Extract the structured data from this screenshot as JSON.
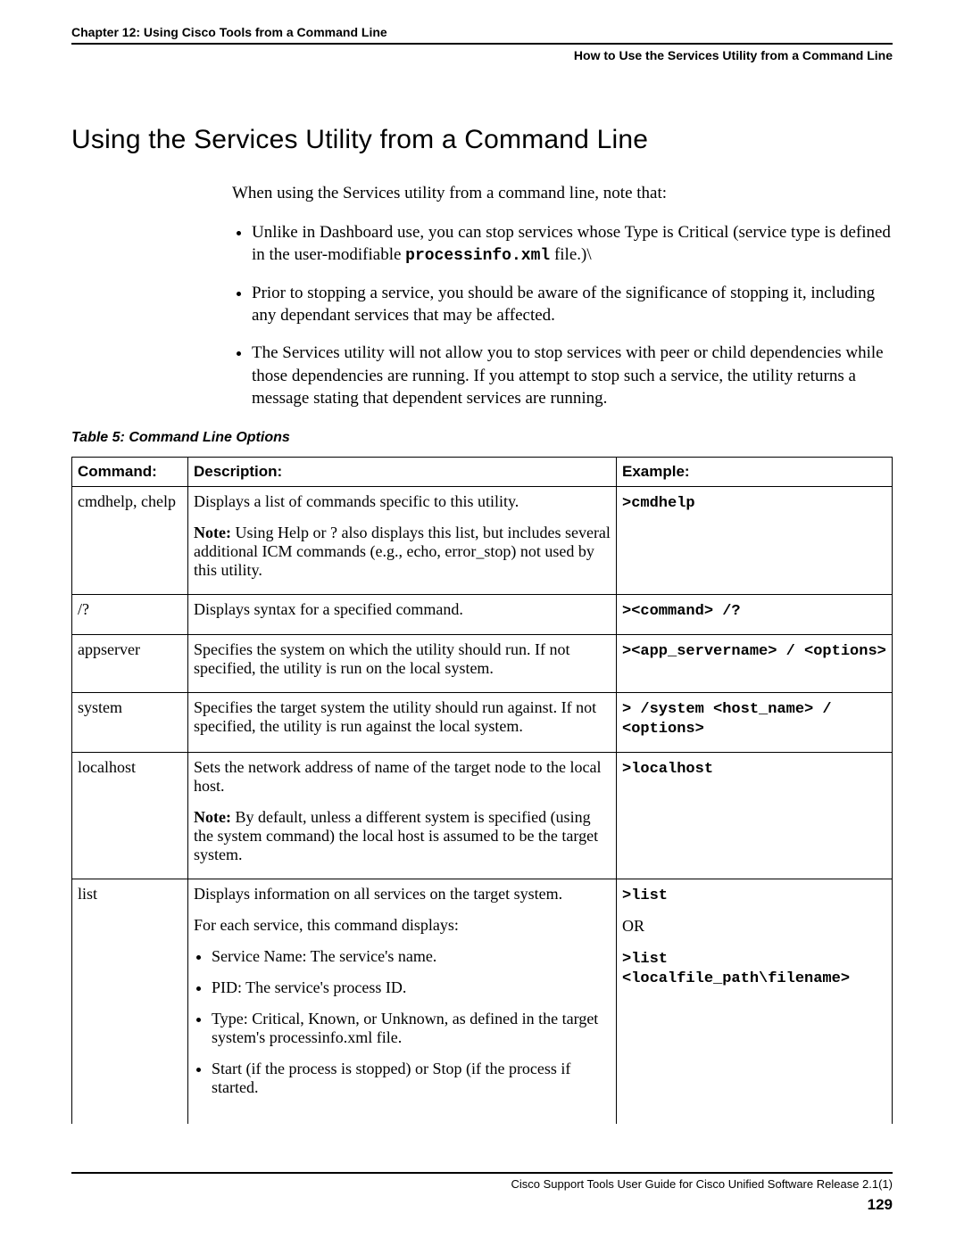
{
  "header": {
    "left": "Chapter 12: Using Cisco Tools from a Command Line",
    "right": "How to Use the Services Utility from a Command Line"
  },
  "title": "Using the Services Utility from a Command Line",
  "intro": "When using the Services utility from a command line, note that:",
  "bullets": {
    "b1_pre": "Unlike in Dashboard use, you can stop services whose Type is Critical (service type is defined in the user-modifiable ",
    "b1_code": "processinfo.xml",
    "b1_post": " file.)\\",
    "b2": "Prior to stopping a service, you should be aware of the significance of stopping it, including any dependant services that may be affected.",
    "b3": "The Services utility will not allow you to stop services with peer or child dependencies while those dependencies are running. If you attempt to stop such a service, the utility returns a message stating that dependent services are running."
  },
  "table_caption": "Table 5: Command Line Options",
  "th": {
    "c1": "Command:",
    "c2": "Description:",
    "c3": "Example:"
  },
  "rows": {
    "r1": {
      "cmd": "cmdhelp, chelp",
      "d1": "Displays a list of commands specific to this utility.",
      "d2_b": "Note:",
      "d2": " Using Help or ? also displays this list, but includes several additional ICM commands (e.g., echo, error_stop) not used by this utility.",
      "ex": ">cmdhelp"
    },
    "r2": {
      "cmd": "/?",
      "d1": "Displays syntax for a specified command.",
      "ex": "><command> /?"
    },
    "r3": {
      "cmd": "appserver",
      "d1": "Specifies the system on which the utility should run. If not specified, the utility is run on the local system.",
      "ex": "><app_servername> / <options>"
    },
    "r4": {
      "cmd": "system",
      "d1": "Specifies the target system the utility should run against. If not specified, the utility is run against the local system.",
      "ex": "> /system <host_name> / <options>"
    },
    "r5": {
      "cmd": "localhost",
      "d1": "Sets the network address of name of the target node to the local host.",
      "d2_b": "Note:",
      "d2": " By default, unless a different system is specified (using the system command) the local host is assumed to be the target system.",
      "ex": ">localhost"
    },
    "r6": {
      "cmd": "list",
      "d1": "Displays information on all services on the target system.",
      "d2": "For each service, this command displays:",
      "li1": "Service Name: The service's name.",
      "li2": "PID: The service's process ID.",
      "li3": "Type: Critical, Known, or Unknown, as defined in the target system's processinfo.xml file.",
      "li4": "Start (if the process is stopped) or Stop (if the process if started.",
      "ex1": ">list",
      "ex_or": "OR",
      "ex2": ">list <localfile_path\\filename>"
    }
  },
  "footer": {
    "title": "Cisco Support Tools User Guide for Cisco Unified Software Release 2.1(1)",
    "page": "129"
  }
}
